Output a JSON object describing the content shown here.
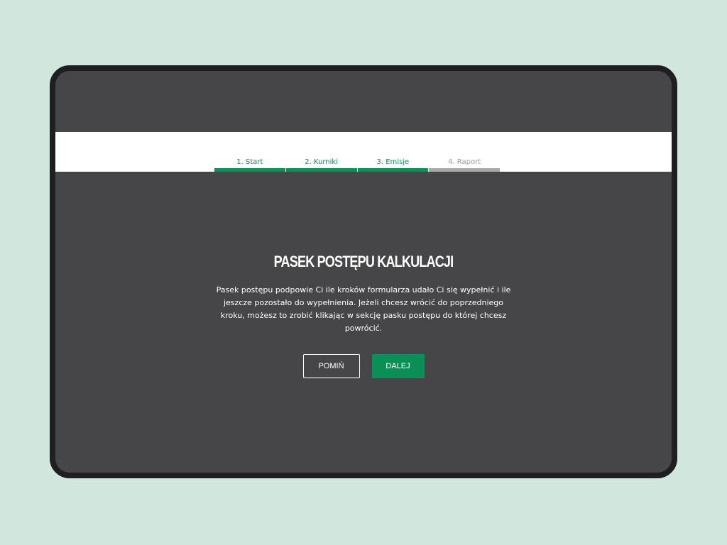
{
  "progress": {
    "steps": [
      {
        "label": "1. Start",
        "state": "completed"
      },
      {
        "label": "2. Kurniki",
        "state": "completed"
      },
      {
        "label": "3. Emisje",
        "state": "completed"
      },
      {
        "label": "4. Raport",
        "state": "inactive"
      }
    ]
  },
  "onboarding": {
    "title": "PASEK POSTĘPU KALKULACJI",
    "description": "Pasek postępu podpowie Ci ile kroków formularza udało Ci się wypełnić i ile jeszcze pozostało do wypełnienia. Jeżeli chcesz wrócić do poprzedniego kroku, możesz to zrobić klikając w sekcję pasku postępu do której chcesz powrócić.",
    "skip_label": "POMIŃ",
    "next_label": "DALEJ"
  },
  "colors": {
    "background": "#d1e6dd",
    "overlay": "#464648",
    "accent_green": "#0a8f57",
    "inactive_gray": "#a8a8a8"
  }
}
